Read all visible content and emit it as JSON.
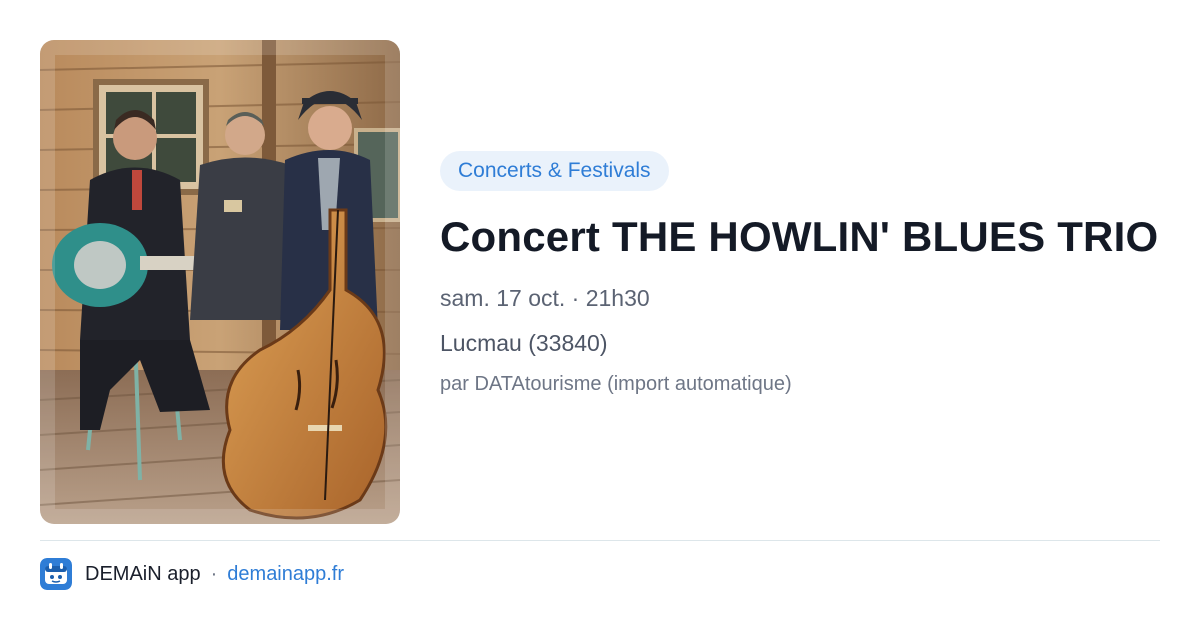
{
  "event": {
    "category": "Concerts & Festivals",
    "title": "Concert THE HOWLIN' BLUES TRIO",
    "when": "sam. 17 oct. · 21h30",
    "where": "Lucmau (33840)",
    "source": "par DATAtourisme (import automatique)"
  },
  "footer": {
    "app_name": "DEMAiN app",
    "separator": "·",
    "url": "demainapp.fr"
  },
  "icons": {
    "photo": "band-photo",
    "logo": "demain-app-logo"
  },
  "colors": {
    "accent": "#2f7dd6",
    "pill_background": "#eaf2fb",
    "title": "#141a26",
    "muted": "#6e7686",
    "divider": "#dde6ea"
  }
}
